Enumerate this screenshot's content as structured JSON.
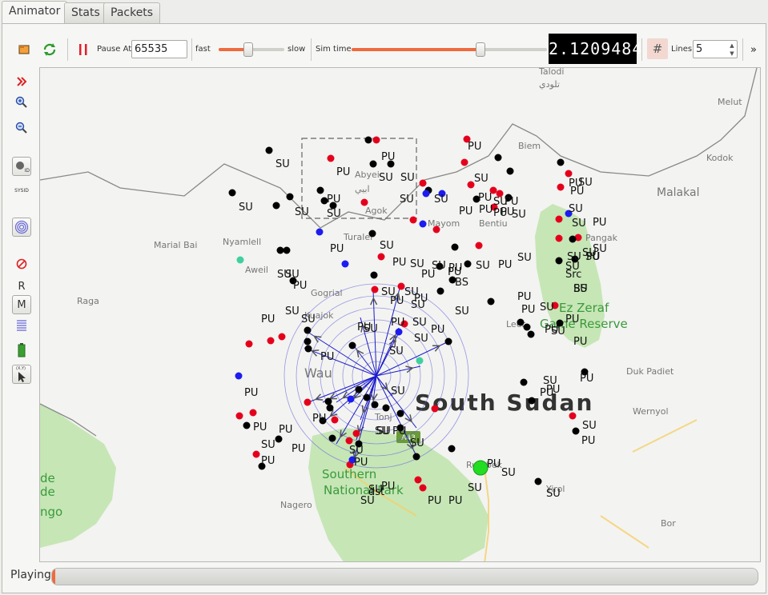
{
  "tabs": [
    {
      "label": "Animator",
      "active": true
    },
    {
      "label": "Stats",
      "active": false
    },
    {
      "label": "Packets",
      "active": false
    }
  ],
  "toolbar": {
    "pause_label": "Pause At",
    "pause_value": "65535",
    "fast_label": "fast",
    "slow_label": "slow",
    "speed_fraction": 0.45,
    "simtime_label": "Sim time",
    "simtime_fraction": 0.66,
    "simtime_value": "2.1209484",
    "lines_label": "Lines",
    "lines_value": "5",
    "overflow_icon": "double-chevron-right-icon"
  },
  "sidebar": {
    "r_label": "R",
    "m_label": "M",
    "sysid_label": "SYSID",
    "id_label": "ID",
    "xy_label": "(X,Y)"
  },
  "status": {
    "label": "Playing",
    "progress_fraction": 0.005
  },
  "colors": {
    "node_black": "#000000",
    "node_red": "#e4001c",
    "node_blue": "#1c1cf0",
    "node_green": "#22dd22",
    "node_teal": "#40d0a0",
    "link": "#1a1acc",
    "accent_orange": "#ef6a3c",
    "park_green": "#c6e6b6",
    "map_bg": "#f3f3f1"
  },
  "map": {
    "places": [
      {
        "name": "Talodi",
        "size": "s"
      },
      {
        "name": "تلودي",
        "size": "s"
      },
      {
        "name": "Melut",
        "size": "s"
      },
      {
        "name": "Kodok",
        "size": "s"
      },
      {
        "name": "Malakal",
        "size": "m"
      },
      {
        "name": "Biem",
        "size": "s"
      },
      {
        "name": "Abyei",
        "size": "s"
      },
      {
        "name": "ابيي",
        "size": "s"
      },
      {
        "name": "Agok",
        "size": "s"
      },
      {
        "name": "Mayom",
        "size": "s"
      },
      {
        "name": "Bentiu",
        "size": "s"
      },
      {
        "name": "Pangak",
        "size": "s"
      },
      {
        "name": "Marial Bai",
        "size": "s"
      },
      {
        "name": "Nyamlell",
        "size": "s"
      },
      {
        "name": "Turalei",
        "size": "s"
      },
      {
        "name": "Aweil",
        "size": "s"
      },
      {
        "name": "Raga",
        "size": "s"
      },
      {
        "name": "Gogrial",
        "size": "s"
      },
      {
        "name": "Kuajok",
        "size": "s"
      },
      {
        "name": "Leer",
        "size": "s"
      },
      {
        "name": "Wau",
        "size": "l"
      },
      {
        "name": "Tonj",
        "size": "s"
      },
      {
        "name": "Rumbek",
        "size": "s"
      },
      {
        "name": "Duk Padiet",
        "size": "s"
      },
      {
        "name": "Wernyol",
        "size": "s"
      },
      {
        "name": "Yirol",
        "size": "s"
      },
      {
        "name": "Nagero",
        "size": "s"
      },
      {
        "name": "Bor",
        "size": "s"
      },
      {
        "name": "A43",
        "size": "shield"
      }
    ],
    "country_label": "South Sudan",
    "parks": [
      "Ez Zeraf",
      "Game Reserve",
      "Southern",
      "National Park",
      "de",
      "de",
      "ngo"
    ],
    "node_labels": [
      "SU",
      "PU",
      "SU",
      "PU",
      "SU",
      "SU",
      "PU",
      "SU",
      "SU",
      "SU",
      "SU",
      "PU",
      "SU",
      "PU",
      "PU",
      "PU",
      "SU",
      "SU",
      "PU",
      "PU",
      "PU",
      "SU",
      "PU",
      "BS",
      "PU",
      "SU",
      "PU",
      "SU",
      "PU",
      "SU",
      "SU",
      "PU",
      "SU",
      "PU",
      "PU",
      "PU",
      "SU",
      "SU",
      "SU",
      "PU",
      "SU",
      "PU",
      "PU",
      "SU",
      "SU",
      "SU",
      "PU",
      "SU",
      "SU",
      "SU",
      "SU",
      "PU",
      "PU",
      "PU",
      "PU",
      "SU",
      "PU",
      "PU",
      "PU",
      "PU",
      "SU",
      "SU",
      "dst",
      "SU",
      "SU",
      "PU",
      "PU",
      "SU",
      "SU",
      "PU",
      "SU",
      "PU",
      "PU",
      "SU",
      "PU",
      "SU",
      "PU",
      "PU",
      "SU",
      "PU",
      "SU",
      "PU",
      "PU",
      "PU",
      "PU",
      "SU",
      "Src",
      "SU",
      "SU",
      "BS",
      "SU",
      "PU",
      "PU",
      "SU",
      "SU",
      "PU",
      "PU",
      "SU",
      "SU",
      "SU",
      "PU",
      "SU",
      "SU",
      "SU",
      "PU",
      "PU",
      "SU",
      "SU",
      "SU"
    ]
  }
}
